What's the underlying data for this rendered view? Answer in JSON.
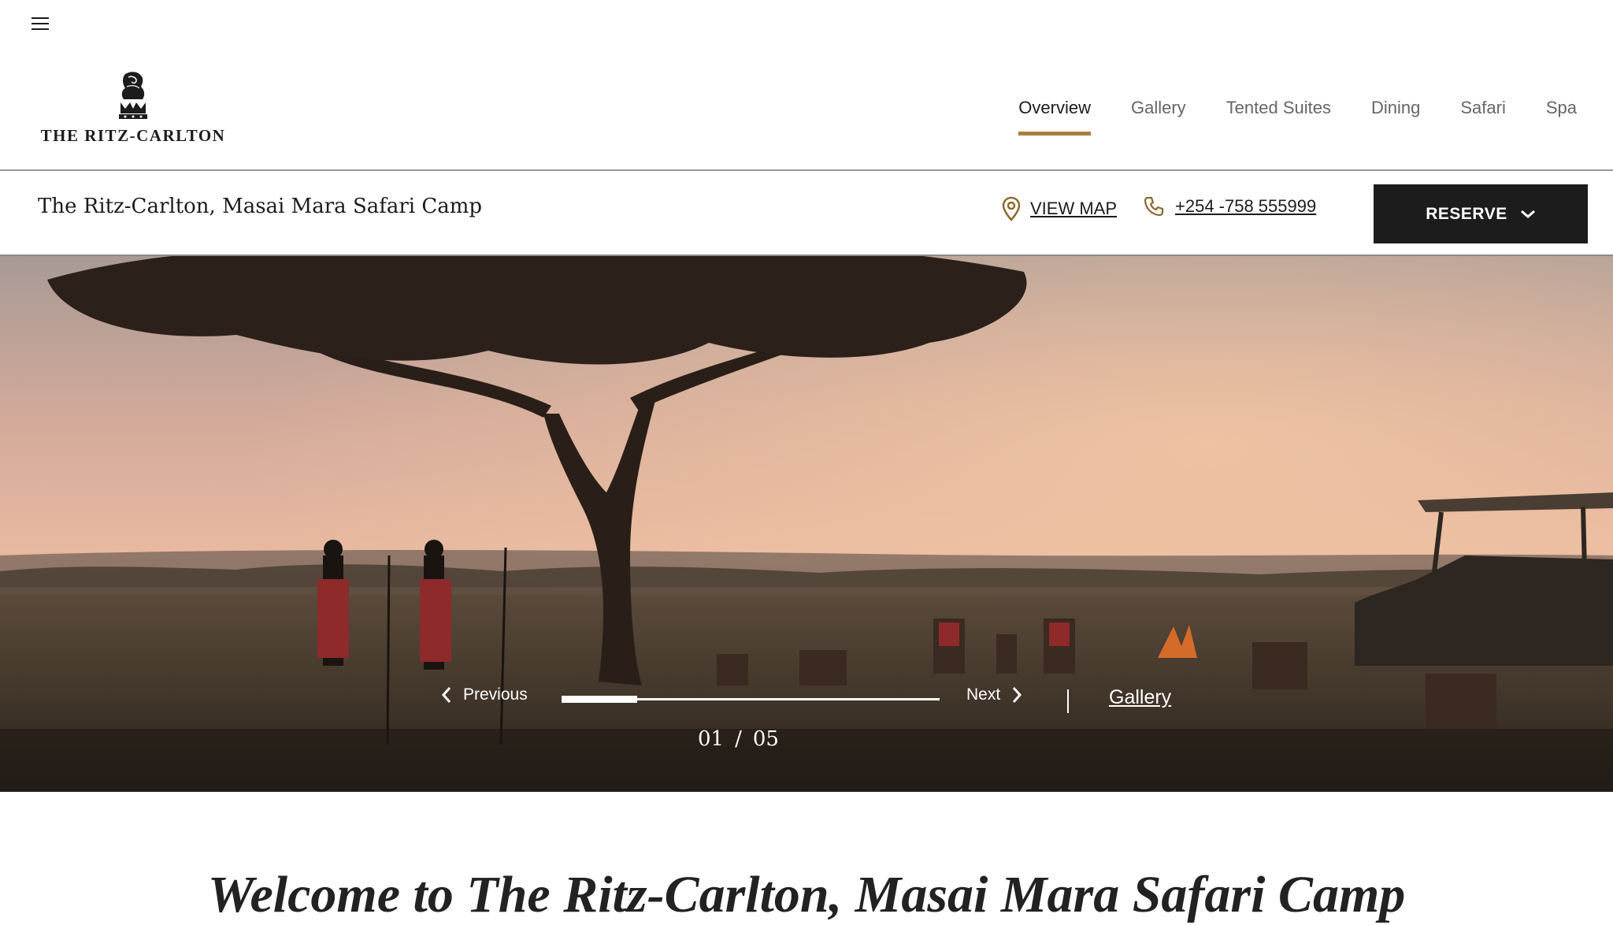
{
  "header": {
    "menu_icon": "hamburger-menu-icon",
    "logo_text": "THE RITZ-CARLTON",
    "nav": [
      {
        "label": "Overview",
        "active": true
      },
      {
        "label": "Gallery",
        "active": false
      },
      {
        "label": "Tented Suites",
        "active": false
      },
      {
        "label": "Dining",
        "active": false
      },
      {
        "label": "Safari",
        "active": false
      },
      {
        "label": "Spa",
        "active": false
      }
    ]
  },
  "subbar": {
    "property_name": "The Ritz-Carlton, Masai Mara Safari Camp",
    "map_label": "VIEW MAP",
    "phone": "+254 -758 555999",
    "reserve_label": "RESERVE"
  },
  "hero": {
    "prev_label": "Previous",
    "next_label": "Next",
    "gallery_label": "Gallery",
    "current": "01",
    "separator": "/",
    "total": "05",
    "progress_fraction": 0.2
  },
  "welcome": "Welcome to The Ritz-Carlton, Masai Mara Safari Camp",
  "colors": {
    "accent": "#a5813f",
    "dark": "#1c1c1c"
  }
}
